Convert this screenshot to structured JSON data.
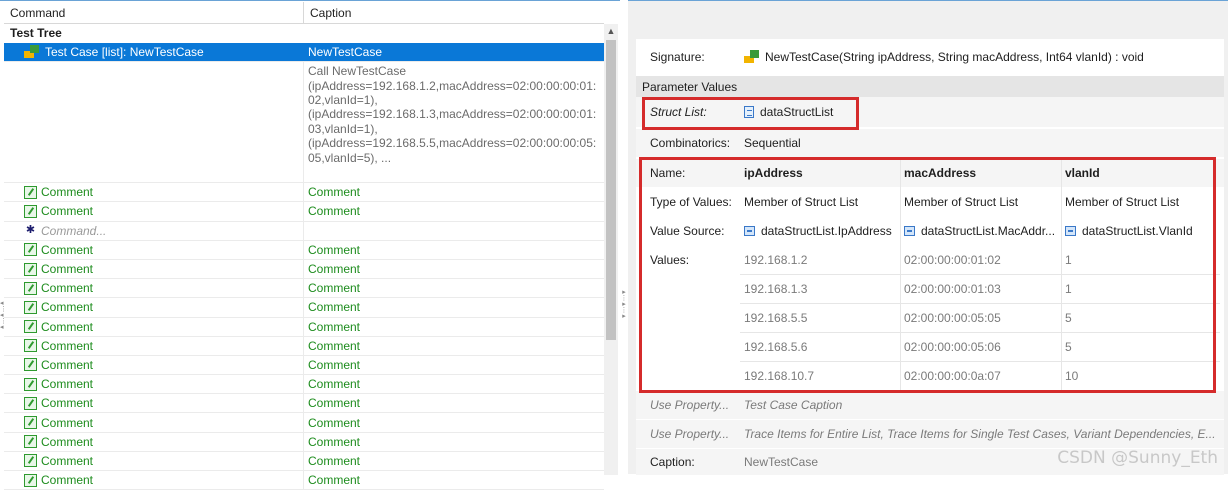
{
  "left": {
    "columns": {
      "command": "Command",
      "caption": "Caption"
    },
    "group_title": "Test Tree",
    "selected": {
      "command": "Test Case [list]: NewTestCase",
      "caption": "NewTestCase"
    },
    "call_caption": "Call NewTestCase\n(ipAddress=192.168.1.2,macAddress=02:00:00:00:01:\n02,vlanId=1),\n(ipAddress=192.168.1.3,macAddress=02:00:00:00:01:\n03,vlanId=1),\n(ipAddress=192.168.5.5,macAddress=02:00:00:00:05:\n05,vlanId=5), ...",
    "comment_label": "Comment",
    "new_command_placeholder": "Command..."
  },
  "right": {
    "signature_label": "Signature:",
    "signature_value": "NewTestCase(String ipAddress, String macAddress, Int64 vlanId) : void",
    "section_title": "Parameter Values",
    "struct_list_label": "Struct List:",
    "struct_list_value": "dataStructList",
    "combinatorics_label": "Combinatorics:",
    "combinatorics_value": "Sequential",
    "name_label": "Name:",
    "type_label": "Type of Values:",
    "source_label": "Value Source:",
    "values_label": "Values:",
    "params": [
      {
        "name": "ipAddress",
        "type": "Member of Struct List",
        "source": "dataStructList.IpAddress"
      },
      {
        "name": "macAddress",
        "type": "Member of Struct List",
        "source": "dataStructList.MacAddr..."
      },
      {
        "name": "vlanId",
        "type": "Member of Struct List",
        "source": "dataStructList.VlanId"
      }
    ],
    "values": [
      [
        "192.168.1.2",
        "02:00:00:00:01:02",
        "1"
      ],
      [
        "192.168.1.3",
        "02:00:00:00:01:03",
        "1"
      ],
      [
        "192.168.5.5",
        "02:00:00:00:05:05",
        "5"
      ],
      [
        "192.168.5.6",
        "02:00:00:00:05:06",
        "5"
      ],
      [
        "192.168.10.7",
        "02:00:00:00:0a:07",
        "10"
      ]
    ],
    "use_property_1": {
      "label": "Use Property...",
      "value": "Test Case Caption"
    },
    "use_property_2": {
      "label": "Use Property...",
      "value": "Trace Items for Entire List, Trace Items for Single Test Cases, Variant Dependencies, E..."
    },
    "caption_label": "Caption:",
    "caption_value": "NewTestCase"
  },
  "watermark": "CSDN @Sunny_Eth",
  "colors": {
    "selection": "#0a78d7",
    "comment_green": "#1d8c1d",
    "highlight_red": "#d52b2b"
  }
}
